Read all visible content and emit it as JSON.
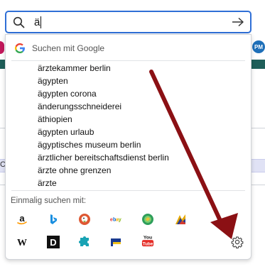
{
  "search": {
    "query": "ä",
    "search_icon": "search-icon",
    "go_icon": "arrow-right-icon"
  },
  "background": {
    "right_badge": "PM",
    "fragment_c": "C"
  },
  "dropdown": {
    "google_label": "Suchen mit Google",
    "google_icon": "google-g-icon",
    "suggestions": [
      "ärztekammer berlin",
      "ägypten",
      "ägypten corona",
      "änderungsschneiderei",
      "äthiopien",
      "ägypten urlaub",
      "ägyptisches museum berlin",
      "ärztlicher bereitschaftsdienst berlin",
      "ärzte ohne grenzen",
      "ärzte"
    ],
    "engines_label": "Einmalig suchen mit:",
    "engines_row1": [
      {
        "name": "amazon",
        "icon": "amazon-icon",
        "glyph": "a",
        "color": "#111111"
      },
      {
        "name": "bing",
        "icon": "bing-icon",
        "glyph": "b",
        "color": "#1a8fe0"
      },
      {
        "name": "duckduckgo",
        "icon": "duckduckgo-icon",
        "glyph": "",
        "color": "#de5833"
      },
      {
        "name": "ebay",
        "icon": "ebay-icon",
        "glyph": "ebay",
        "color": "#e53238"
      },
      {
        "name": "ecosia",
        "icon": "ecosia-icon",
        "glyph": "",
        "color": "#2e9e5b"
      },
      {
        "name": "leo",
        "icon": "leo-icon",
        "glyph": "",
        "color": "#e6a800"
      }
    ],
    "engines_row2": [
      {
        "name": "wikipedia",
        "icon": "wikipedia-icon",
        "glyph": "W",
        "color": "#111111"
      },
      {
        "name": "dict",
        "icon": "dict-icon",
        "glyph": "D",
        "color": "#ffffff"
      },
      {
        "name": "puzzle",
        "icon": "puzzle-icon",
        "glyph": "",
        "color": "#19a3b4"
      },
      {
        "name": "flag",
        "icon": "flag-icon",
        "glyph": "",
        "color": "#1a3a8f"
      },
      {
        "name": "youtube",
        "icon": "youtube-icon",
        "glyph": "You Tube",
        "color": "#e52d27"
      }
    ],
    "settings_icon": "gear-icon"
  },
  "annotation": {
    "color": "#8b1014"
  }
}
